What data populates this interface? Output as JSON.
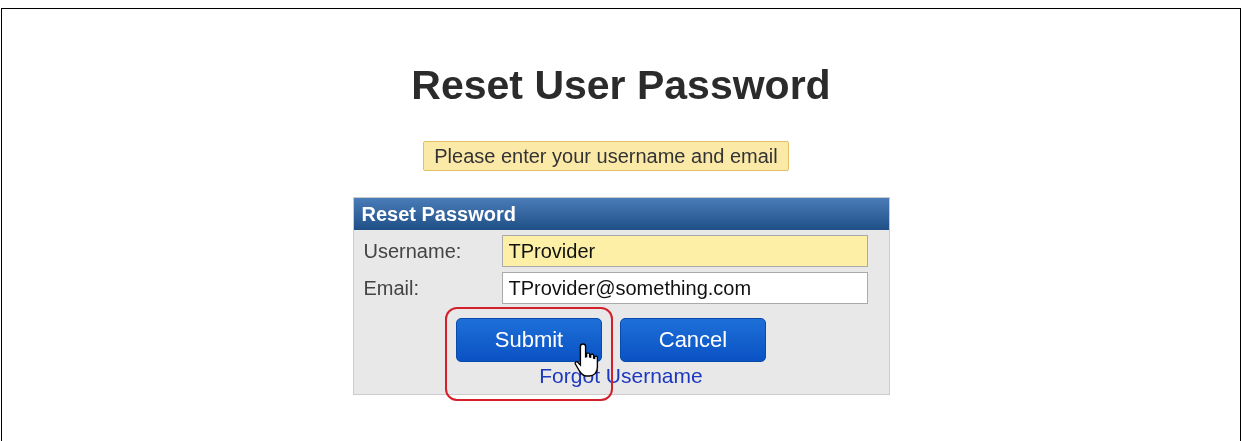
{
  "title": "Reset User Password",
  "notice": "Please enter your username and email",
  "panel": {
    "title": "Reset Password",
    "fields": [
      {
        "label": "Username:",
        "value": "TProvider",
        "focused": true
      },
      {
        "label": "Email:",
        "value": "TProvider@something.com",
        "focused": false
      }
    ],
    "buttons": [
      {
        "label": "Submit",
        "highlighted": true
      },
      {
        "label": "Cancel",
        "highlighted": false
      }
    ],
    "link": "Forgot Username"
  }
}
